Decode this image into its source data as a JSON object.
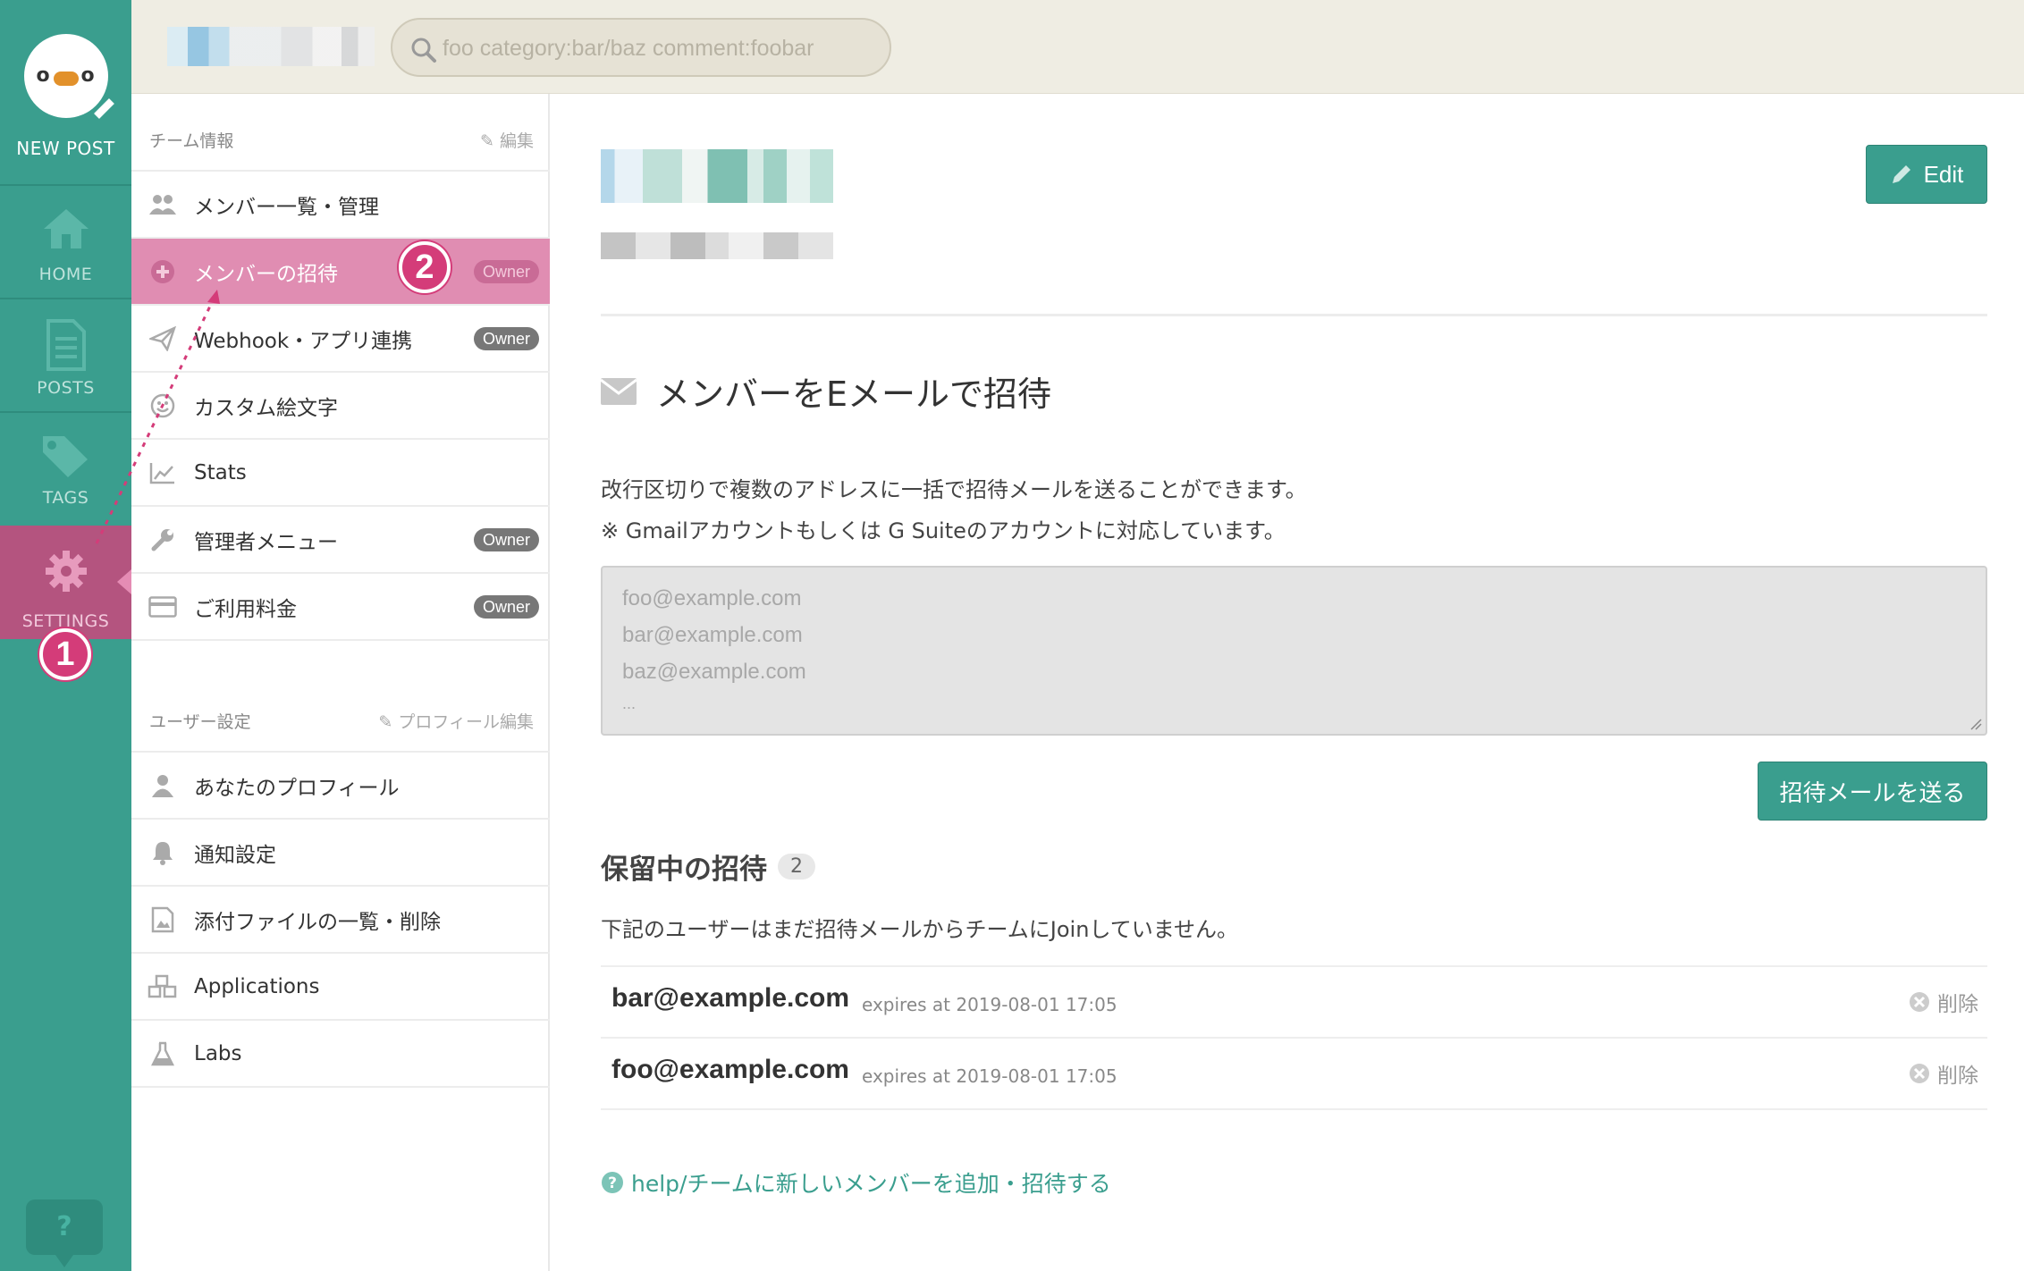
{
  "rail": {
    "logo_left": "o",
    "logo_right": "o",
    "new_post": "NEW POST",
    "home": "HOME",
    "posts": "POSTS",
    "tags": "TAGS",
    "settings": "SETTINGS",
    "help": "?"
  },
  "search": {
    "placeholder": "foo category:bar/baz comment:foobar"
  },
  "nav": {
    "team_header": "チーム情報",
    "team_edit": "編集",
    "team_items": [
      {
        "label": "メンバー一覧・管理",
        "badge": ""
      },
      {
        "label": "メンバーの招待",
        "badge": "Owner"
      },
      {
        "label": "Webhook・アプリ連携",
        "badge": "Owner"
      },
      {
        "label": "カスタム絵文字",
        "badge": ""
      },
      {
        "label": "Stats",
        "badge": ""
      },
      {
        "label": "管理者メニュー",
        "badge": "Owner"
      },
      {
        "label": "ご利用料金",
        "badge": "Owner"
      }
    ],
    "user_header": "ユーザー設定",
    "user_edit": "プロフィール編集",
    "user_items": [
      {
        "label": "あなたのプロフィール"
      },
      {
        "label": "通知設定"
      },
      {
        "label": "添付ファイルの一覧・削除"
      },
      {
        "label": "Applications"
      },
      {
        "label": "Labs"
      }
    ]
  },
  "annotations": {
    "step1": "1",
    "step2": "2"
  },
  "main": {
    "edit_button": "Edit",
    "section_title": "メンバーをEメールで招待",
    "desc1": "改行区切りで複数のアドレスに一括で招待メールを送ることができます。",
    "desc2": "※ Gmailアカウントもしくは G Suiteのアカウントに対応しています。",
    "textarea_lines": [
      "foo@example.com",
      "bar@example.com",
      "baz@example.com",
      "..."
    ],
    "send_button": "招待メールを送る",
    "pending_title": "保留中の招待",
    "pending_count": "2",
    "pending_desc": "下記のユーザーはまだ招待メールからチームにJoinしていません。",
    "invites": [
      {
        "email": "bar@example.com",
        "expires": "expires at 2019-08-01 17:05",
        "delete": "削除"
      },
      {
        "email": "foo@example.com",
        "expires": "expires at 2019-08-01 17:05",
        "delete": "削除"
      }
    ],
    "help_link": "help/チームに新しいメンバーを追加・招待する"
  },
  "colors": {
    "rail": "#3a9e8e",
    "accent": "#3a9e8e",
    "active_nav": "#e08db2",
    "settings_active": "#b4547f",
    "annotation": "#d43c79",
    "topbar": "#efede3"
  }
}
